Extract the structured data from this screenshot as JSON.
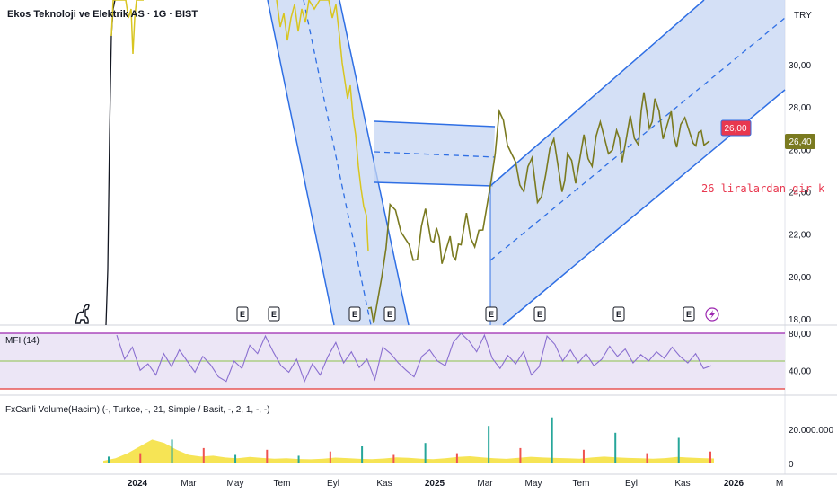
{
  "header": {
    "title": "Ekos Teknoloji ve Elektrik AS · 1G · BIST",
    "currency": "TRY"
  },
  "annotation": {
    "note_text": "26 liralardan gir k",
    "alert_label": "26,00",
    "last_price_label": "26,40"
  },
  "indicators": {
    "mfi_label": "MFI (14)",
    "volume_label": "FxCanli Volume(Hacim) (-, Turkce, -, 21, Simple / Basit, -, 2, 1, -, -)"
  },
  "colors": {
    "price_line": "#7a7a20",
    "price_line_bright": "#d8c520",
    "channel_fill": "#c6d5f3",
    "channel_line": "#2f6fe4",
    "mfi_line": "#8a6fd0",
    "mfi_band": "#ece6f6",
    "mfi_upper": "#9c27b0",
    "mfi_lower": "#e53935",
    "mfi_mid": "#8bc34a",
    "volume_area": "#f5e142",
    "volume_up": "#26a69a",
    "volume_down": "#ef5350",
    "alert": "#e8384f",
    "last_price": "#7a7a20"
  },
  "chart_data": [
    {
      "type": "line",
      "name_note": "price",
      "y_ticks": [
        "30,00",
        "28,00",
        "26,00",
        "24,00",
        "22,00",
        "20,00",
        "18,00"
      ],
      "ylim": [
        17.9,
        32.0
      ],
      "x_ticks": [
        "2024",
        "Mar",
        "May",
        "Tem",
        "Eyl",
        "Kas",
        "2025",
        "Mar",
        "May",
        "Tem",
        "Eyl",
        "Kas",
        "2026",
        "M"
      ],
      "events": [
        "E",
        "E",
        "E",
        "E",
        "E",
        "E",
        "E",
        "E"
      ],
      "series": [
        {
          "x_month": [
            3,
            3.6,
            4,
            4.3,
            4.6,
            5,
            5.2,
            5.5,
            5.8,
            6,
            6.2,
            6.5,
            6.8,
            7,
            7.2,
            7.4,
            7.6,
            7.8,
            8,
            8.2,
            8.4,
            8.6,
            8.8,
            9,
            9.2,
            9.4,
            9.6,
            9.8,
            10,
            10.2,
            10.5,
            10.8,
            11,
            11.3,
            11.6,
            12,
            12.3,
            12.6,
            12.9,
            13.1,
            13.3,
            13.5,
            13.8,
            14,
            14.2,
            14.4,
            14.7,
            15,
            15.3,
            15.6,
            15.9,
            16.2,
            16.5,
            16.8,
            17,
            17.3,
            17.6,
            17.9,
            18.1,
            18.4,
            18.7,
            19,
            19.3,
            19.6,
            19.9,
            20.1,
            20.4,
            20.7,
            20.9,
            21.1,
            21.3,
            21.6,
            21.9,
            22.1,
            22.4,
            22.7,
            22.9,
            23.1,
            23.3
          ],
          "values": [
            32.5,
            31.2,
            33.0,
            31.5,
            32.6,
            30.2,
            29.5,
            27.0,
            25.2,
            23.8,
            21.2,
            24.5,
            23.4,
            27.2,
            25.8,
            26.3,
            24.9,
            26.9,
            25.4,
            27.1,
            25.0,
            26.2,
            24.5,
            24.1,
            22.8,
            22.1,
            21.0,
            19.6,
            21.5,
            22.3,
            20.5,
            18.5,
            17.8,
            20.0,
            23.4,
            22.1,
            21.5,
            20.8,
            23.2,
            21.7,
            22.3,
            20.6,
            21.9,
            20.8,
            21.5,
            23.0,
            21.4,
            22.2,
            24.5,
            27.8,
            26.2,
            25.4,
            24.0,
            25.6,
            23.5,
            24.8,
            26.5,
            24.0,
            25.8,
            24.4,
            26.7,
            25.2,
            27.3,
            25.8,
            26.9,
            25.4,
            27.6,
            26.2,
            28.7,
            27.0,
            28.4,
            26.5,
            27.8,
            26.1,
            27.5,
            26.3,
            26.8,
            26.2,
            26.4
          ]
        }
      ],
      "channels": [
        {
          "from": [
            "2023-Ara-18",
            32.0
          ],
          "to": [
            "2024-Kas-15",
            17.9
          ],
          "width_price": 5.2,
          "style": "falling"
        },
        {
          "from": [
            "2024-Kas-01",
            27.3
          ],
          "to": [
            "2025-Mar-05",
            27.2
          ],
          "lower": 24.4,
          "style": "horizontal"
        },
        {
          "from": [
            "2025-Mar-05",
            24.4
          ],
          "to": [
            "2025-Ara-10",
            32.0
          ],
          "lower_start": 17.9,
          "lower_end": 26.2,
          "style": "rising"
        }
      ]
    },
    {
      "type": "line",
      "title": "MFI (14)",
      "y_ticks": [
        "80,00",
        "40,00"
      ],
      "ylim": [
        20,
        85
      ],
      "levels": [
        80,
        50,
        20
      ],
      "values": [
        78,
        52,
        65,
        40,
        47,
        35,
        58,
        44,
        62,
        50,
        38,
        55,
        46,
        33,
        28,
        50,
        42,
        67,
        58,
        77,
        60,
        45,
        38,
        52,
        28,
        47,
        35,
        55,
        70,
        48,
        60,
        43,
        52,
        30,
        65,
        58,
        48,
        40,
        33,
        55,
        62,
        50,
        45,
        70,
        80,
        72,
        60,
        78,
        53,
        42,
        56,
        47,
        60,
        35,
        44,
        77,
        68,
        50,
        62,
        48,
        58,
        45,
        52,
        66,
        55,
        63,
        48,
        57,
        50,
        60,
        53,
        65,
        55,
        48,
        58,
        42,
        45
      ]
    },
    {
      "type": "bar",
      "title": "FxCanli Volume(Hacim) (-, Turkce, -, 21, Simple / Basit, -, 2, 1, -, -)",
      "y_ticks": [
        "20.000.000",
        "0"
      ],
      "ylim": [
        0,
        30000000
      ],
      "average_values": [
        1500000,
        3000000,
        6000000,
        10000000,
        14000000,
        12000000,
        8000000,
        5000000,
        4000000,
        4500000,
        3500000,
        3000000,
        3800000,
        3200000,
        2800000,
        3000000,
        2600000,
        2400000,
        2800000,
        3400000,
        3100000,
        2700000,
        2500000,
        2900000,
        3600000,
        3300000,
        2800000,
        2500000,
        3000000,
        3800000,
        4200000,
        3600000,
        3000000,
        2700000,
        3300000,
        3900000,
        3500000,
        3200000,
        3000000,
        2800000,
        3500000,
        4000000,
        3600000,
        3200000,
        3000000,
        2800000,
        3100000,
        3800000,
        3400000,
        3100000,
        2900000
      ],
      "spikes": [
        4000000,
        6000000,
        14000000,
        9000000,
        5000000,
        8000000,
        4500000,
        7000000,
        10000000,
        5000000,
        12000000,
        6000000,
        22000000,
        9000000,
        27000000,
        8000000,
        18000000,
        6000000,
        15000000,
        7000000
      ]
    }
  ]
}
